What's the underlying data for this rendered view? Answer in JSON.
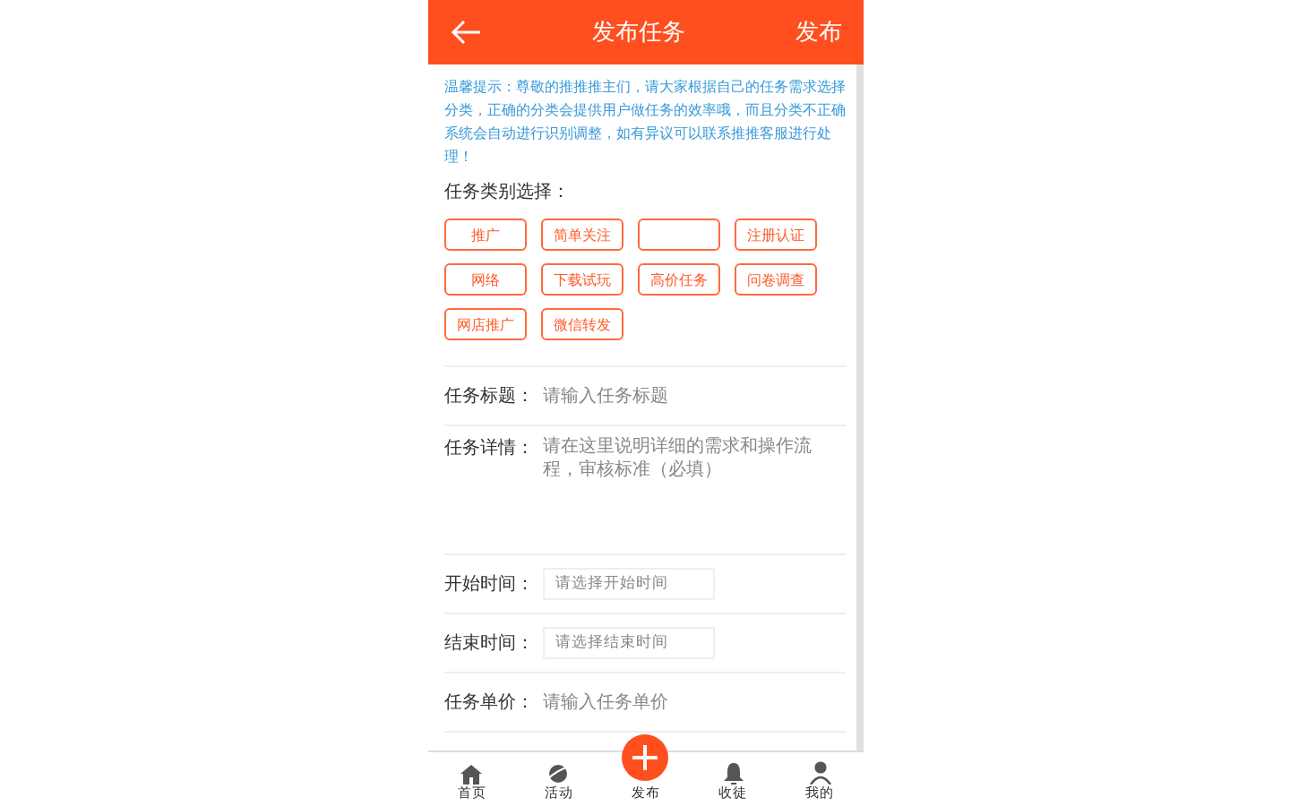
{
  "header": {
    "title": "发布任务",
    "action": "发布"
  },
  "tip": "温馨提示：尊敬的推推推主们，请大家根据自己的任务需求选择分类，正确的分类会提供用户做任务的效率哦，而且分类不正确系统会自动进行识别调整，如有异议可以联系推推客服进行处理！",
  "category_label": "任务类别选择：",
  "categories": [
    {
      "kind": "text",
      "label": "推广"
    },
    {
      "kind": "text",
      "label": "简单关注"
    },
    {
      "kind": "empty"
    },
    {
      "kind": "text",
      "label": "注册认证"
    },
    {
      "kind": "text",
      "label": "网络"
    },
    {
      "kind": "text",
      "label": "下载试玩"
    },
    {
      "kind": "text",
      "label": "高价任务"
    },
    {
      "kind": "text",
      "label": "问卷调查"
    },
    {
      "kind": "text",
      "label": "网店推广"
    },
    {
      "kind": "text",
      "label": "微信转发"
    }
  ],
  "fields": [
    {
      "kind": "input",
      "label": "任务标题：",
      "placeholder": "请输入任务标题"
    },
    {
      "kind": "textarea",
      "label": "任务详情：",
      "placeholder": "请在这里说明详细的需求和操作流程，审核标准（必填）"
    },
    {
      "kind": "picker",
      "label": "开始时间：",
      "placeholder": "请选择开始时间"
    },
    {
      "kind": "picker",
      "label": "结束时间：",
      "placeholder": "请选择结束时间"
    },
    {
      "kind": "input",
      "label": "任务单价：",
      "placeholder": "请输入任务单价"
    }
  ],
  "tabbar": [
    {
      "kind": "home",
      "label": "首页"
    },
    {
      "kind": "planet",
      "label": "活动"
    },
    {
      "kind": "publish",
      "label": "发布"
    },
    {
      "kind": "bell",
      "label": "收徒"
    },
    {
      "kind": "user",
      "label": "我的"
    }
  ]
}
